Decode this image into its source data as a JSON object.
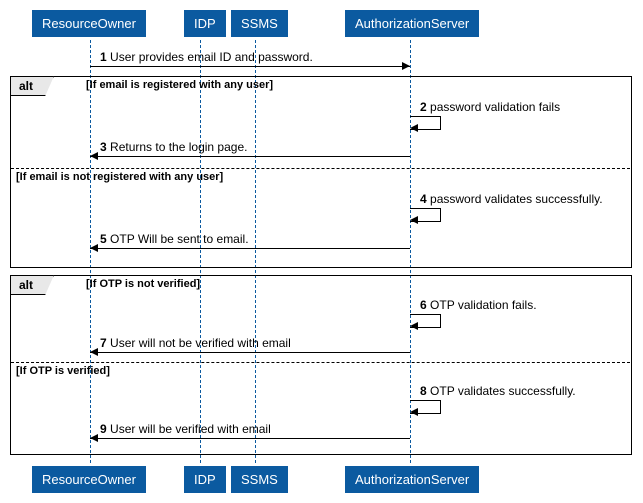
{
  "chart_data": {
    "type": "sequence-diagram",
    "participants": [
      "ResourceOwner",
      "IDP",
      "SSMS",
      "AuthorizationServer"
    ],
    "messages": [
      {
        "n": 1,
        "from": "ResourceOwner",
        "to": "AuthorizationServer",
        "text": "User provides email ID and password."
      },
      {
        "n": 2,
        "from": "AuthorizationServer",
        "to": "AuthorizationServer",
        "text": "password validation fails"
      },
      {
        "n": 3,
        "from": "AuthorizationServer",
        "to": "ResourceOwner",
        "text": "Returns to the login page."
      },
      {
        "n": 4,
        "from": "AuthorizationServer",
        "to": "AuthorizationServer",
        "text": "password validates successfully."
      },
      {
        "n": 5,
        "from": "AuthorizationServer",
        "to": "ResourceOwner",
        "text": "OTP Will be sent to email."
      },
      {
        "n": 6,
        "from": "AuthorizationServer",
        "to": "AuthorizationServer",
        "text": "OTP validation fails."
      },
      {
        "n": 7,
        "from": "AuthorizationServer",
        "to": "ResourceOwner",
        "text": "User will not be verified with email"
      },
      {
        "n": 8,
        "from": "AuthorizationServer",
        "to": "AuthorizationServer",
        "text": "OTP validates successfully."
      },
      {
        "n": 9,
        "from": "AuthorizationServer",
        "to": "ResourceOwner",
        "text": "User will be verified with email"
      }
    ],
    "fragments": [
      {
        "type": "alt",
        "guards": [
          "[If email is registered with any user]",
          "[If email is not registered with any user]"
        ],
        "covers": [
          [
            2,
            3
          ],
          [
            4,
            5
          ]
        ]
      },
      {
        "type": "alt",
        "guards": [
          "[If OTP is not verified]",
          "[If OTP is verified]"
        ],
        "covers": [
          [
            6,
            7
          ],
          [
            8,
            9
          ]
        ]
      }
    ]
  },
  "p": {
    "ro": "ResourceOwner",
    "idp": "IDP",
    "ssms": "SSMS",
    "auth": "AuthorizationServer"
  },
  "alt": "alt",
  "g1a": "[If email is registered with any user]",
  "g1b": "[If email is not registered with any user]",
  "g2a": "[If OTP is not verified]",
  "g2b": "[If OTP is verified]",
  "m1n": "1",
  "m1": "User provides email ID and password.",
  "m2n": "2",
  "m2": "password validation fails",
  "m3n": "3",
  "m3": "Returns to the login page.",
  "m4n": "4",
  "m4": "password validates successfully.",
  "m5n": "5",
  "m5": "OTP Will be sent to email.",
  "m6n": "6",
  "m6": "OTP validation fails.",
  "m7n": "7",
  "m7": "User will not be verified with email",
  "m8n": "8",
  "m8": "OTP validates successfully.",
  "m9n": "9",
  "m9": "User will be verified with email"
}
